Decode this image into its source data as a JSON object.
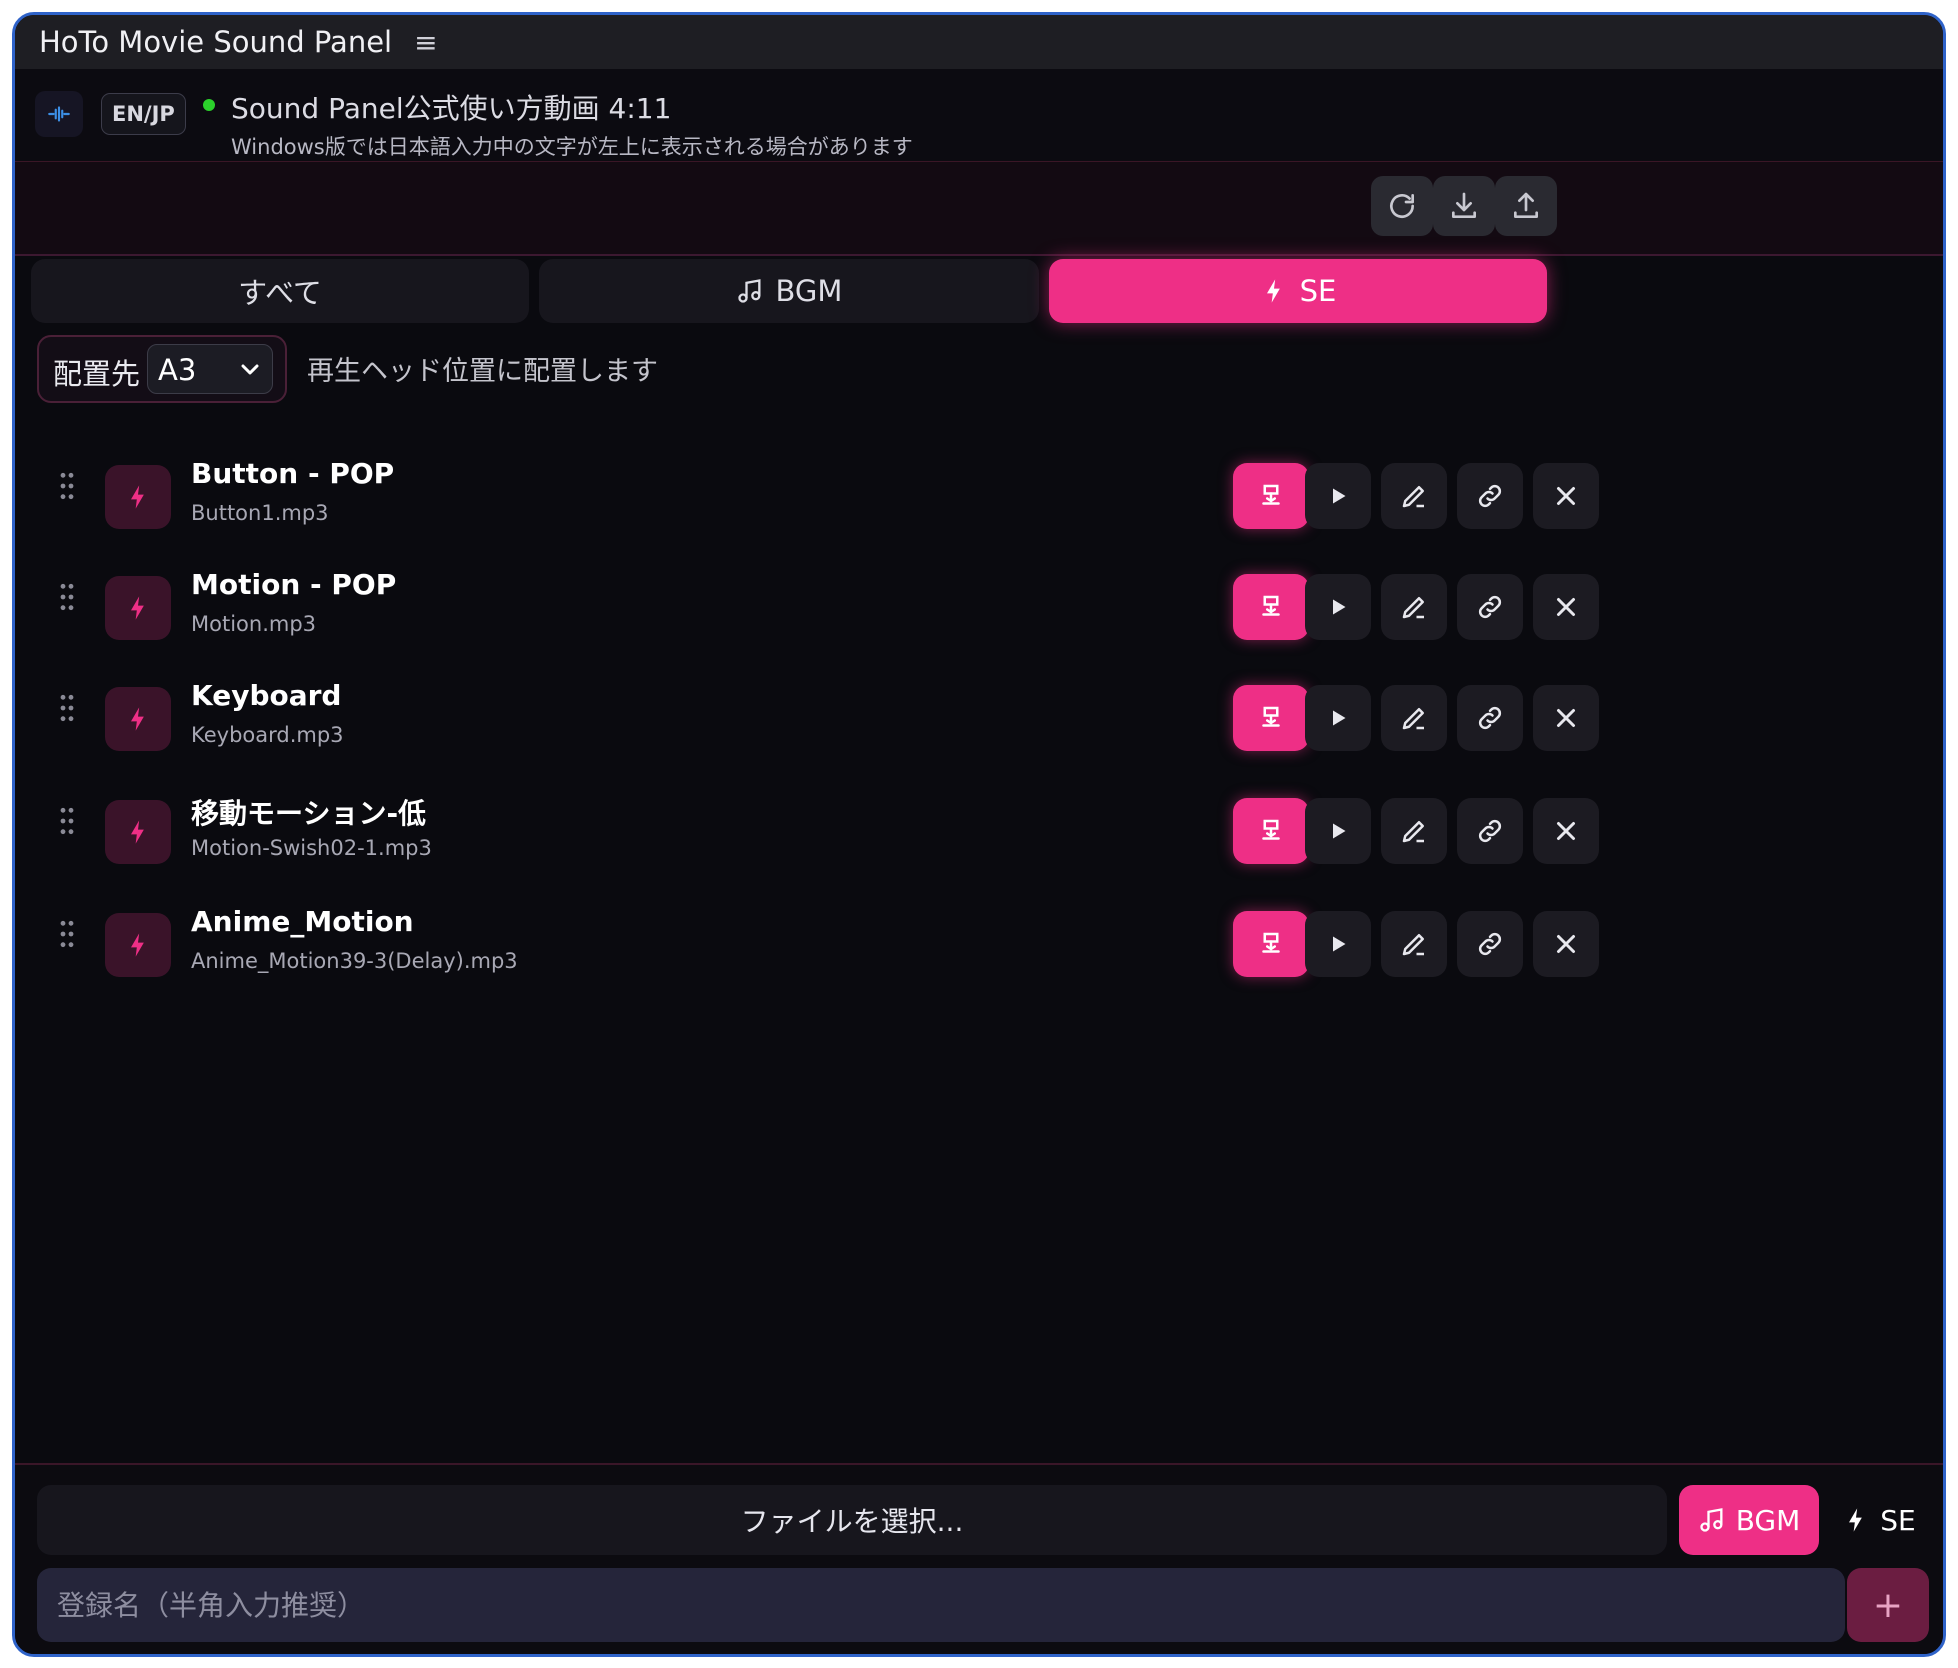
{
  "app": {
    "title": "HoTo Movie Sound Panel",
    "menu_glyph": "≡"
  },
  "info": {
    "lang_label": "EN/JP",
    "line1": "Sound Panel公式使い方動画 4:11",
    "line2": "Windows版では日本語入力中の文字が左上に表示される場合があります",
    "status_color": "#2bd12b"
  },
  "toolbar": {
    "buttons": [
      "refresh-icon",
      "download-icon",
      "upload-icon"
    ]
  },
  "tabs": [
    {
      "label": "すべて",
      "icon": "",
      "active": false
    },
    {
      "label": "BGM",
      "icon": "music-note-icon",
      "active": false
    },
    {
      "label": "SE",
      "icon": "lightning-icon",
      "active": true
    }
  ],
  "placement": {
    "label": "配置先",
    "value": "A3",
    "hint": "再生ヘッド位置に配置します"
  },
  "sounds": [
    {
      "name": "Button - POP",
      "file": "Button1.mp3"
    },
    {
      "name": "Motion - POP",
      "file": "Motion.mp3"
    },
    {
      "name": "Keyboard",
      "file": "Keyboard.mp3"
    },
    {
      "name": "移動モーション-低",
      "file": "Motion-Swish02-1.mp3"
    },
    {
      "name": "Anime_Motion",
      "file": "Anime_Motion39-3(Delay).mp3"
    }
  ],
  "row_actions": [
    "place-icon",
    "play-icon",
    "edit-icon",
    "link-icon",
    "close-icon"
  ],
  "bottom": {
    "file_button": "ファイルを選択...",
    "type_bgm": "BGM",
    "type_se": "SE",
    "name_placeholder": "登録名（半角入力推奨）",
    "add_glyph": "+"
  },
  "colors": {
    "accent": "#ee2f86",
    "background": "#0a0a0f",
    "frame": "#2f63c9"
  }
}
